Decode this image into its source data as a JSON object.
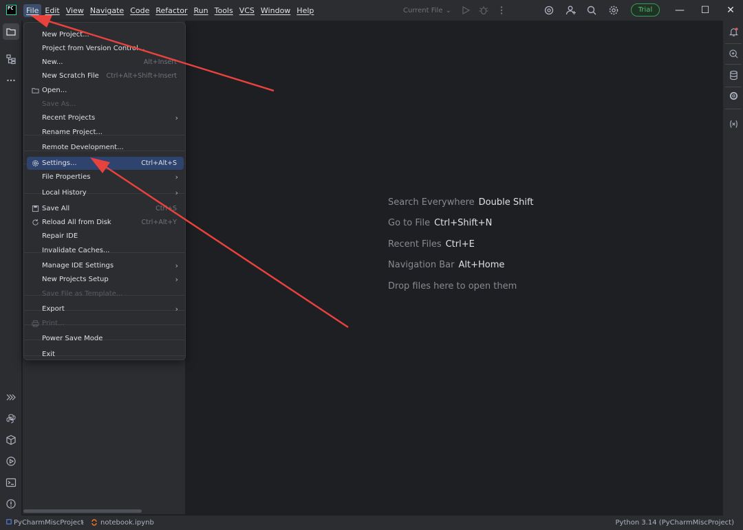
{
  "app": {
    "logo_text": "PC"
  },
  "menubar": [
    "File",
    "Edit",
    "View",
    "Navigate",
    "Code",
    "Refactor",
    "Run",
    "Tools",
    "VCS",
    "Window",
    "Help"
  ],
  "toolbar": {
    "run_config": "Current File",
    "trial_label": "Trial"
  },
  "window_controls": {
    "minimize": "—",
    "maximize": "☐",
    "close": "✕"
  },
  "file_menu": {
    "items": [
      {
        "label": "New Project...",
        "shortcut": "",
        "icon": "",
        "disabled": false,
        "submenu": false
      },
      {
        "label": "Project from Version Control...",
        "shortcut": "",
        "icon": "",
        "disabled": false,
        "submenu": false
      },
      {
        "label": "New...",
        "shortcut": "Alt+Insert",
        "icon": "",
        "disabled": false,
        "submenu": false
      },
      {
        "label": "New Scratch File",
        "shortcut": "Ctrl+Alt+Shift+Insert",
        "icon": "",
        "disabled": false,
        "submenu": false
      },
      {
        "label": "Open...",
        "shortcut": "",
        "icon": "folder-icon",
        "disabled": false,
        "submenu": false
      },
      {
        "label": "Save As...",
        "shortcut": "",
        "icon": "",
        "disabled": true,
        "submenu": false
      },
      {
        "label": "Recent Projects",
        "shortcut": "",
        "icon": "",
        "disabled": false,
        "submenu": true
      },
      {
        "label": "Rename Project...",
        "shortcut": "",
        "icon": "",
        "disabled": false,
        "submenu": false
      },
      {
        "label": "Remote Development...",
        "shortcut": "",
        "icon": "",
        "disabled": false,
        "submenu": false
      },
      {
        "label": "Settings...",
        "shortcut": "Ctrl+Alt+S",
        "icon": "gear-icon",
        "disabled": false,
        "submenu": false,
        "selected": true
      },
      {
        "label": "File Properties",
        "shortcut": "",
        "icon": "",
        "disabled": false,
        "submenu": true
      },
      {
        "label": "Local History",
        "shortcut": "",
        "icon": "",
        "disabled": false,
        "submenu": true
      },
      {
        "label": "Save All",
        "shortcut": "Ctrl+S",
        "icon": "save-icon",
        "disabled": false,
        "submenu": false
      },
      {
        "label": "Reload All from Disk",
        "shortcut": "Ctrl+Alt+Y",
        "icon": "reload-icon",
        "disabled": false,
        "submenu": false
      },
      {
        "label": "Repair IDE",
        "shortcut": "",
        "icon": "",
        "disabled": false,
        "submenu": false
      },
      {
        "label": "Invalidate Caches...",
        "shortcut": "",
        "icon": "",
        "disabled": false,
        "submenu": false
      },
      {
        "label": "Manage IDE Settings",
        "shortcut": "",
        "icon": "",
        "disabled": false,
        "submenu": true
      },
      {
        "label": "New Projects Setup",
        "shortcut": "",
        "icon": "",
        "disabled": false,
        "submenu": true
      },
      {
        "label": "Save File as Template...",
        "shortcut": "",
        "icon": "",
        "disabled": true,
        "submenu": false
      },
      {
        "label": "Export",
        "shortcut": "",
        "icon": "",
        "disabled": false,
        "submenu": true
      },
      {
        "label": "Print...",
        "shortcut": "",
        "icon": "print-icon",
        "disabled": true,
        "submenu": false
      },
      {
        "label": "Power Save Mode",
        "shortcut": "",
        "icon": "",
        "disabled": false,
        "submenu": false
      },
      {
        "label": "Exit",
        "shortcut": "",
        "icon": "",
        "disabled": false,
        "submenu": false
      }
    ]
  },
  "editor_hints": [
    {
      "text": "Search Everywhere",
      "key": "Double Shift"
    },
    {
      "text": "Go to File",
      "key": "Ctrl+Shift+N"
    },
    {
      "text": "Recent Files",
      "key": "Ctrl+E"
    },
    {
      "text": "Navigation Bar",
      "key": "Alt+Home"
    },
    {
      "text": "Drop files here to open them",
      "key": ""
    }
  ],
  "statusbar": {
    "project": "PyCharmMiscProject",
    "file": "notebook.ipynb",
    "interpreter": "Python 3.14 (PyCharmMiscProject)"
  },
  "colors": {
    "accent": "#2e436e",
    "annotation_arrow": "#e8423f",
    "trial_green": "#5bb872"
  }
}
